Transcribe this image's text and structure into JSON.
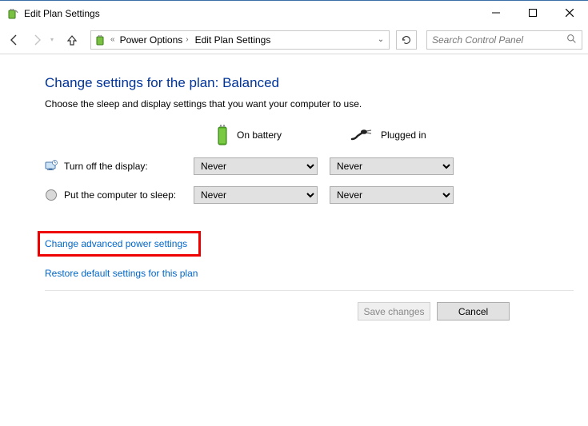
{
  "window": {
    "title": "Edit Plan Settings"
  },
  "breadcrumb": {
    "item1": "Power Options",
    "item2": "Edit Plan Settings"
  },
  "search": {
    "placeholder": "Search Control Panel"
  },
  "page": {
    "title": "Change settings for the plan: Balanced",
    "subtitle": "Choose the sleep and display settings that you want your computer to use."
  },
  "columns": {
    "battery": "On battery",
    "plugged": "Plugged in"
  },
  "settings": {
    "display_label": "Turn off the display:",
    "sleep_label": "Put the computer to sleep:",
    "display_battery": "Never",
    "display_plugged": "Never",
    "sleep_battery": "Never",
    "sleep_plugged": "Never"
  },
  "links": {
    "advanced": "Change advanced power settings",
    "restore": "Restore default settings for this plan"
  },
  "buttons": {
    "save": "Save changes",
    "cancel": "Cancel"
  }
}
